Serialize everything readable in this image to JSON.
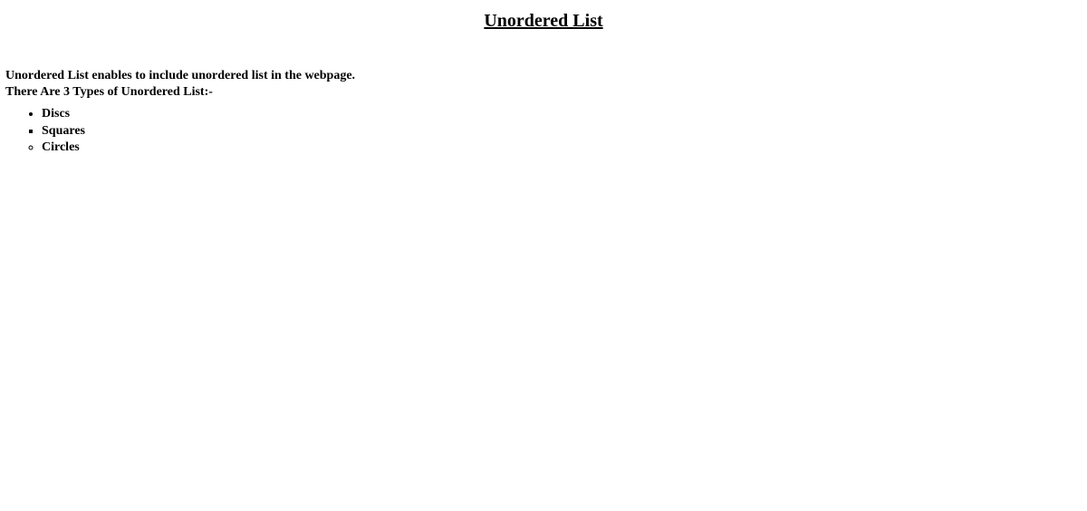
{
  "title": "Unordered List",
  "intro": {
    "line1": "Unordered List enables to include unordered list in the webpage.",
    "line2": "There Are 3 Types of Unordered List:-"
  },
  "list": {
    "items": [
      {
        "label": "Discs"
      },
      {
        "label": "Squares"
      },
      {
        "label": "Circles"
      }
    ]
  }
}
